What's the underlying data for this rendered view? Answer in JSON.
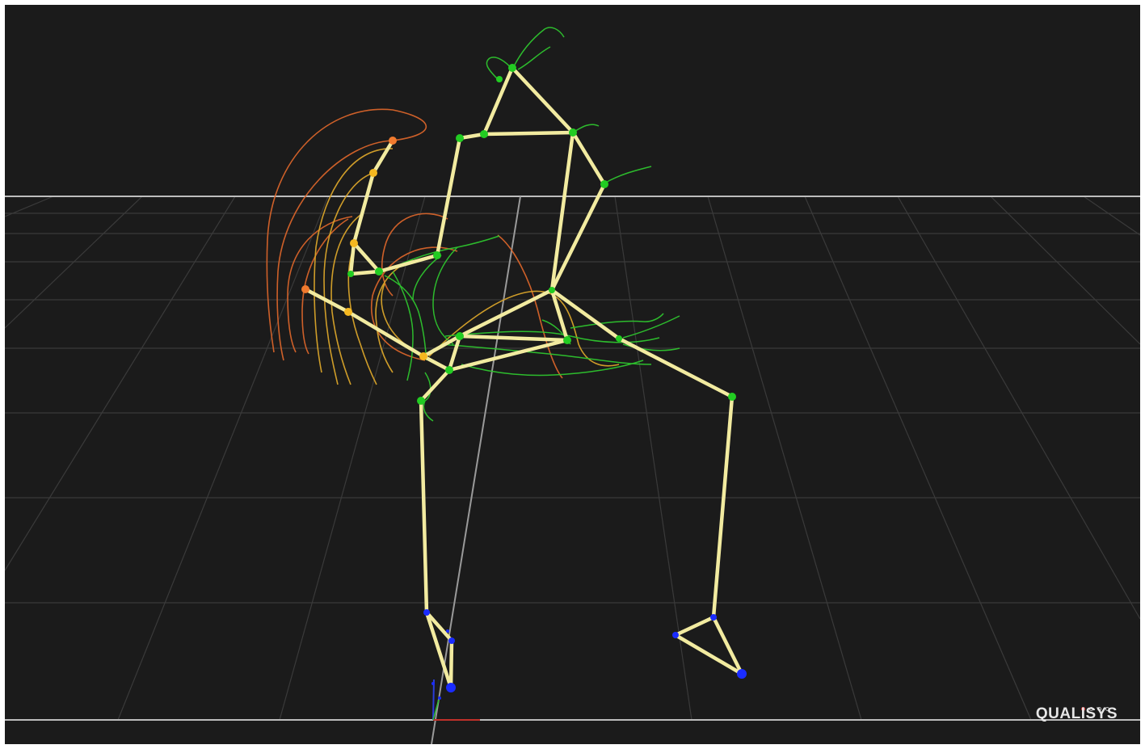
{
  "viewer": {
    "brand": "QUALISYS",
    "colors": {
      "background": "#1b1b1b",
      "bone": "#f2eba0",
      "marker_torso": "#22cc22",
      "marker_arm_orange": "#f07a2e",
      "marker_arm_yellow": "#f5b820",
      "marker_foot": "#1a2cff",
      "trail_green": "#2ec52e",
      "trail_orange": "#d8642a",
      "trail_yellow": "#d9a42a",
      "grid": "#3a3a3a",
      "horizon": "#bdbdbd"
    }
  }
}
